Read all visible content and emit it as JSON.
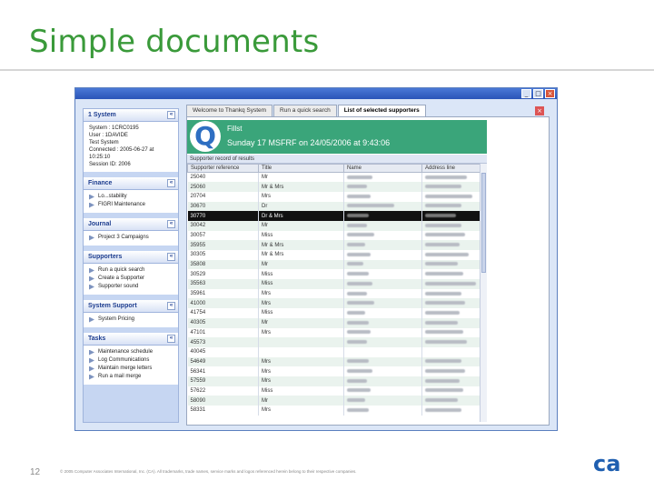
{
  "slide": {
    "title": "Simple documents",
    "page_number": "12",
    "copyright": "© 2005 Computer Associates International, Inc. (CA). All trademarks, trade names, service marks and logos referenced herein belong to their respective companies.",
    "logo_text": "ca"
  },
  "window": {
    "minimize": "_",
    "maximize": "□",
    "close": "×"
  },
  "sidebar": {
    "sections": [
      {
        "title": "1 System",
        "info": [
          "System : 1CRC0195",
          "User : 1DAVIDE",
          "Test System",
          "Connected : 2005-06-27 at 10:25:10",
          "Session ID: 2006"
        ],
        "links": []
      },
      {
        "title": "Finance",
        "info": [],
        "links": [
          "Lo...stability",
          "FIGRI Maintenance"
        ]
      },
      {
        "title": "Journal",
        "info": [],
        "links": [
          "Project 3 Campaigns"
        ]
      },
      {
        "title": "Supporters",
        "info": [],
        "links": [
          "Run a quick search",
          "Create a Supporter",
          "Supporter sound"
        ]
      },
      {
        "title": "System Support",
        "info": [],
        "links": [
          "System Pricing"
        ]
      },
      {
        "title": "Tasks",
        "info": [],
        "links": [
          "Maintenance schedule",
          "Log Communications",
          "Maintain merge letters",
          "Run a mail merge"
        ]
      }
    ],
    "collapse_glyph": "«"
  },
  "tabs": [
    {
      "label": "Welcome to Thankq System",
      "active": false
    },
    {
      "label": "Run a quick search",
      "active": false
    },
    {
      "label": "List of selected supporters",
      "active": true
    }
  ],
  "tab_close": "×",
  "banner": {
    "logo": "Q",
    "title": "Fillst",
    "subtitle": "Sunday 17 MSFRF on 24/05/2006 at 9:43:06"
  },
  "grid": {
    "label": "Supporter record of results",
    "columns": [
      "Supporter reference",
      "Title",
      "Name",
      "Address line"
    ],
    "rows": [
      {
        "ref": "25040",
        "title": "Mr",
        "name_w": 28,
        "addr_w": 46,
        "state": "normal"
      },
      {
        "ref": "25060",
        "title": "Mr & Mrs",
        "name_w": 22,
        "addr_w": 40,
        "state": "alt"
      },
      {
        "ref": "20704",
        "title": "Mrs",
        "name_w": 26,
        "addr_w": 52,
        "state": "normal"
      },
      {
        "ref": "30670",
        "title": "Dr",
        "name_w": 52,
        "addr_w": 40,
        "state": "alt"
      },
      {
        "ref": "30770",
        "title": "Dr & Mrs",
        "name_w": 24,
        "addr_w": 34,
        "state": "sel"
      },
      {
        "ref": "30042",
        "title": "Mr",
        "name_w": 22,
        "addr_w": 40,
        "state": "alt"
      },
      {
        "ref": "30057",
        "title": "Miss",
        "name_w": 30,
        "addr_w": 44,
        "state": "normal"
      },
      {
        "ref": "35955",
        "title": "Mr & Mrs",
        "name_w": 20,
        "addr_w": 38,
        "state": "alt"
      },
      {
        "ref": "30305",
        "title": "Mr & Mrs",
        "name_w": 26,
        "addr_w": 48,
        "state": "normal"
      },
      {
        "ref": "35808",
        "title": "Mr",
        "name_w": 18,
        "addr_w": 36,
        "state": "alt"
      },
      {
        "ref": "30529",
        "title": "Miss",
        "name_w": 24,
        "addr_w": 42,
        "state": "normal"
      },
      {
        "ref": "35563",
        "title": "Miss",
        "name_w": 28,
        "addr_w": 56,
        "state": "alt"
      },
      {
        "ref": "35961",
        "title": "Mrs",
        "name_w": 22,
        "addr_w": 40,
        "state": "normal"
      },
      {
        "ref": "41000",
        "title": "Mrs",
        "name_w": 30,
        "addr_w": 44,
        "state": "alt"
      },
      {
        "ref": "41754",
        "title": "Miss",
        "name_w": 20,
        "addr_w": 38,
        "state": "normal"
      },
      {
        "ref": "40305",
        "title": "Mr",
        "name_w": 24,
        "addr_w": 36,
        "state": "alt"
      },
      {
        "ref": "47101",
        "title": "Mrs",
        "name_w": 26,
        "addr_w": 42,
        "state": "normal"
      },
      {
        "ref": "45573",
        "title": "",
        "name_w": 22,
        "addr_w": 46,
        "state": "alt"
      },
      {
        "ref": "40045",
        "title": "",
        "name_w": 0,
        "addr_w": 0,
        "state": "normal"
      },
      {
        "ref": "54649",
        "title": "Mrs",
        "name_w": 24,
        "addr_w": 40,
        "state": "alt"
      },
      {
        "ref": "56341",
        "title": "Mrs",
        "name_w": 28,
        "addr_w": 44,
        "state": "normal"
      },
      {
        "ref": "57559",
        "title": "Mrs",
        "name_w": 22,
        "addr_w": 38,
        "state": "alt"
      },
      {
        "ref": "57622",
        "title": "Miss",
        "name_w": 26,
        "addr_w": 42,
        "state": "normal"
      },
      {
        "ref": "58090",
        "title": "Mr",
        "name_w": 20,
        "addr_w": 36,
        "state": "alt"
      },
      {
        "ref": "58331",
        "title": "Mrs",
        "name_w": 24,
        "addr_w": 40,
        "state": "normal"
      }
    ]
  }
}
